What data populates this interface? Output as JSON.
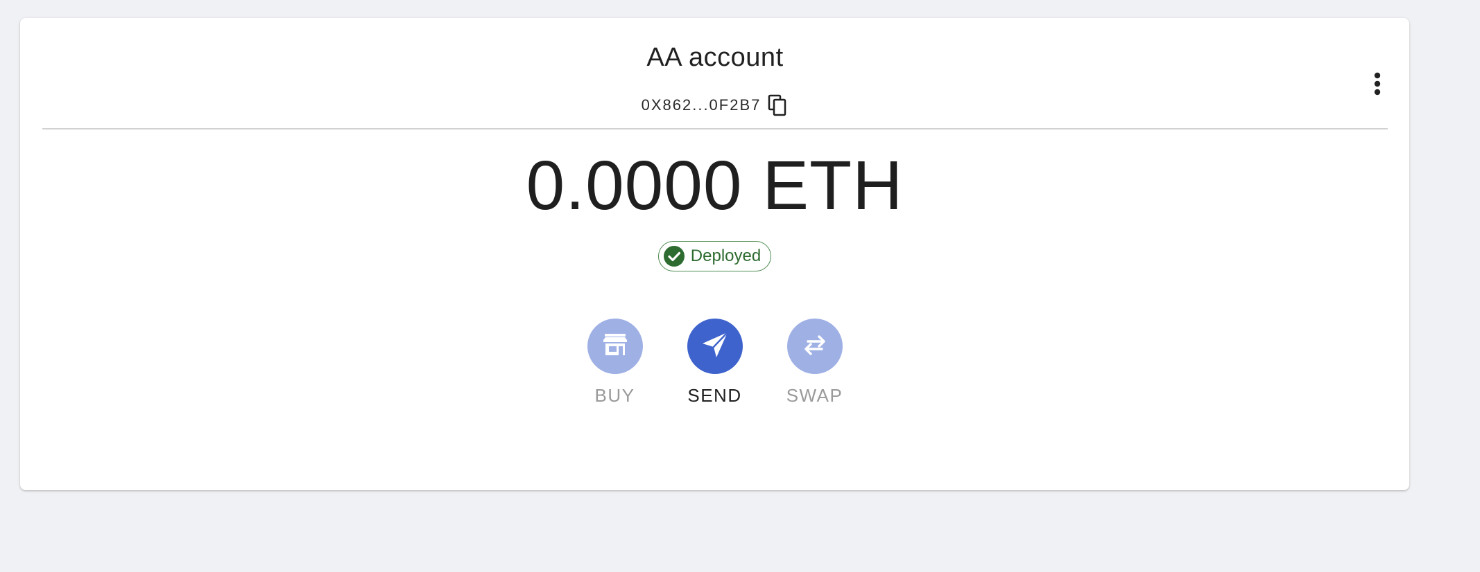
{
  "account": {
    "title": "AA account",
    "address": "0X862...0F2B7"
  },
  "balance": {
    "text": "0.0000 ETH"
  },
  "status": {
    "label": "Deployed",
    "color": "#2e6b30",
    "icon": "check-circle-icon"
  },
  "actions": [
    {
      "label": "BUY",
      "icon": "store-icon",
      "state": "disabled"
    },
    {
      "label": "SEND",
      "icon": "send-icon",
      "state": "active"
    },
    {
      "label": "SWAP",
      "icon": "swap-icon",
      "state": "disabled"
    }
  ],
  "colors": {
    "primary": "#3f63cc",
    "primary_disabled": "#9fb0e5",
    "background": "#f0f1f4",
    "card": "#ffffff"
  },
  "icons": {
    "copy": "copy-icon",
    "menu": "more-vertical-icon"
  }
}
